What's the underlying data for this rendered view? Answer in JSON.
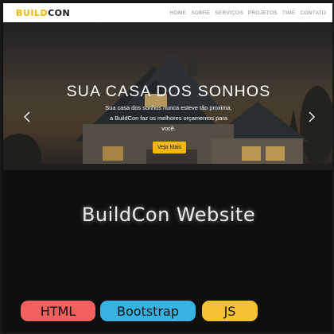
{
  "navbar": {
    "brand_part1": "BUILD",
    "brand_part2": "CON",
    "links": [
      "HOME",
      "SOBRE",
      "SERVIÇOS",
      "PROJETOS",
      "TIME",
      "CONTATO"
    ]
  },
  "hero": {
    "title": "SUA CASA DOS SONHOS",
    "text_line1": "Sua casa dos sonhos nunca esteve tão proxima,",
    "text_line2": "a BuildCon faz os melhores orçamentos para",
    "text_line3": "você.",
    "button_label": "Veja Mais"
  },
  "project": {
    "title": "BuildCon Website",
    "badges": [
      "HTML",
      "Bootstrap",
      "JS"
    ]
  },
  "colors": {
    "brand_yellow": "#f1b70a",
    "badge_html": "#f0605d",
    "badge_bootstrap": "#37b3e3",
    "badge_js": "#f3c132"
  }
}
